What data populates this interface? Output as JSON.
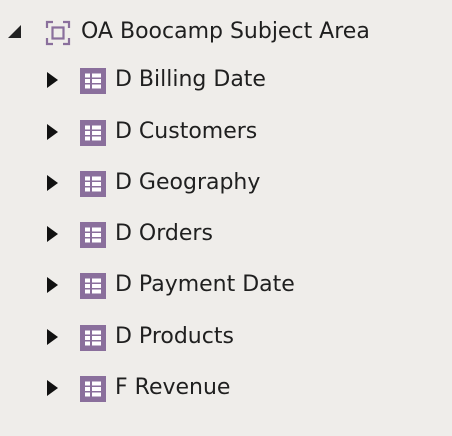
{
  "tree": {
    "root": {
      "label": "OA Boocamp Subject Area",
      "icon": "subject-area-icon",
      "state": "expanded"
    },
    "children": [
      {
        "label": "D Billing Date",
        "icon": "table-icon",
        "state": "collapsed"
      },
      {
        "label": "D Customers",
        "icon": "table-icon",
        "state": "collapsed"
      },
      {
        "label": "D Geography",
        "icon": "table-icon",
        "state": "collapsed"
      },
      {
        "label": "D Orders",
        "icon": "table-icon",
        "state": "collapsed"
      },
      {
        "label": "D Payment Date",
        "icon": "table-icon",
        "state": "collapsed"
      },
      {
        "label": "D Products",
        "icon": "table-icon",
        "state": "collapsed"
      },
      {
        "label": "F Revenue",
        "icon": "table-icon",
        "state": "collapsed"
      }
    ]
  },
  "colors": {
    "background": "#efedea",
    "icon_purple": "#8a6f9c",
    "text": "#1f1f1f"
  }
}
